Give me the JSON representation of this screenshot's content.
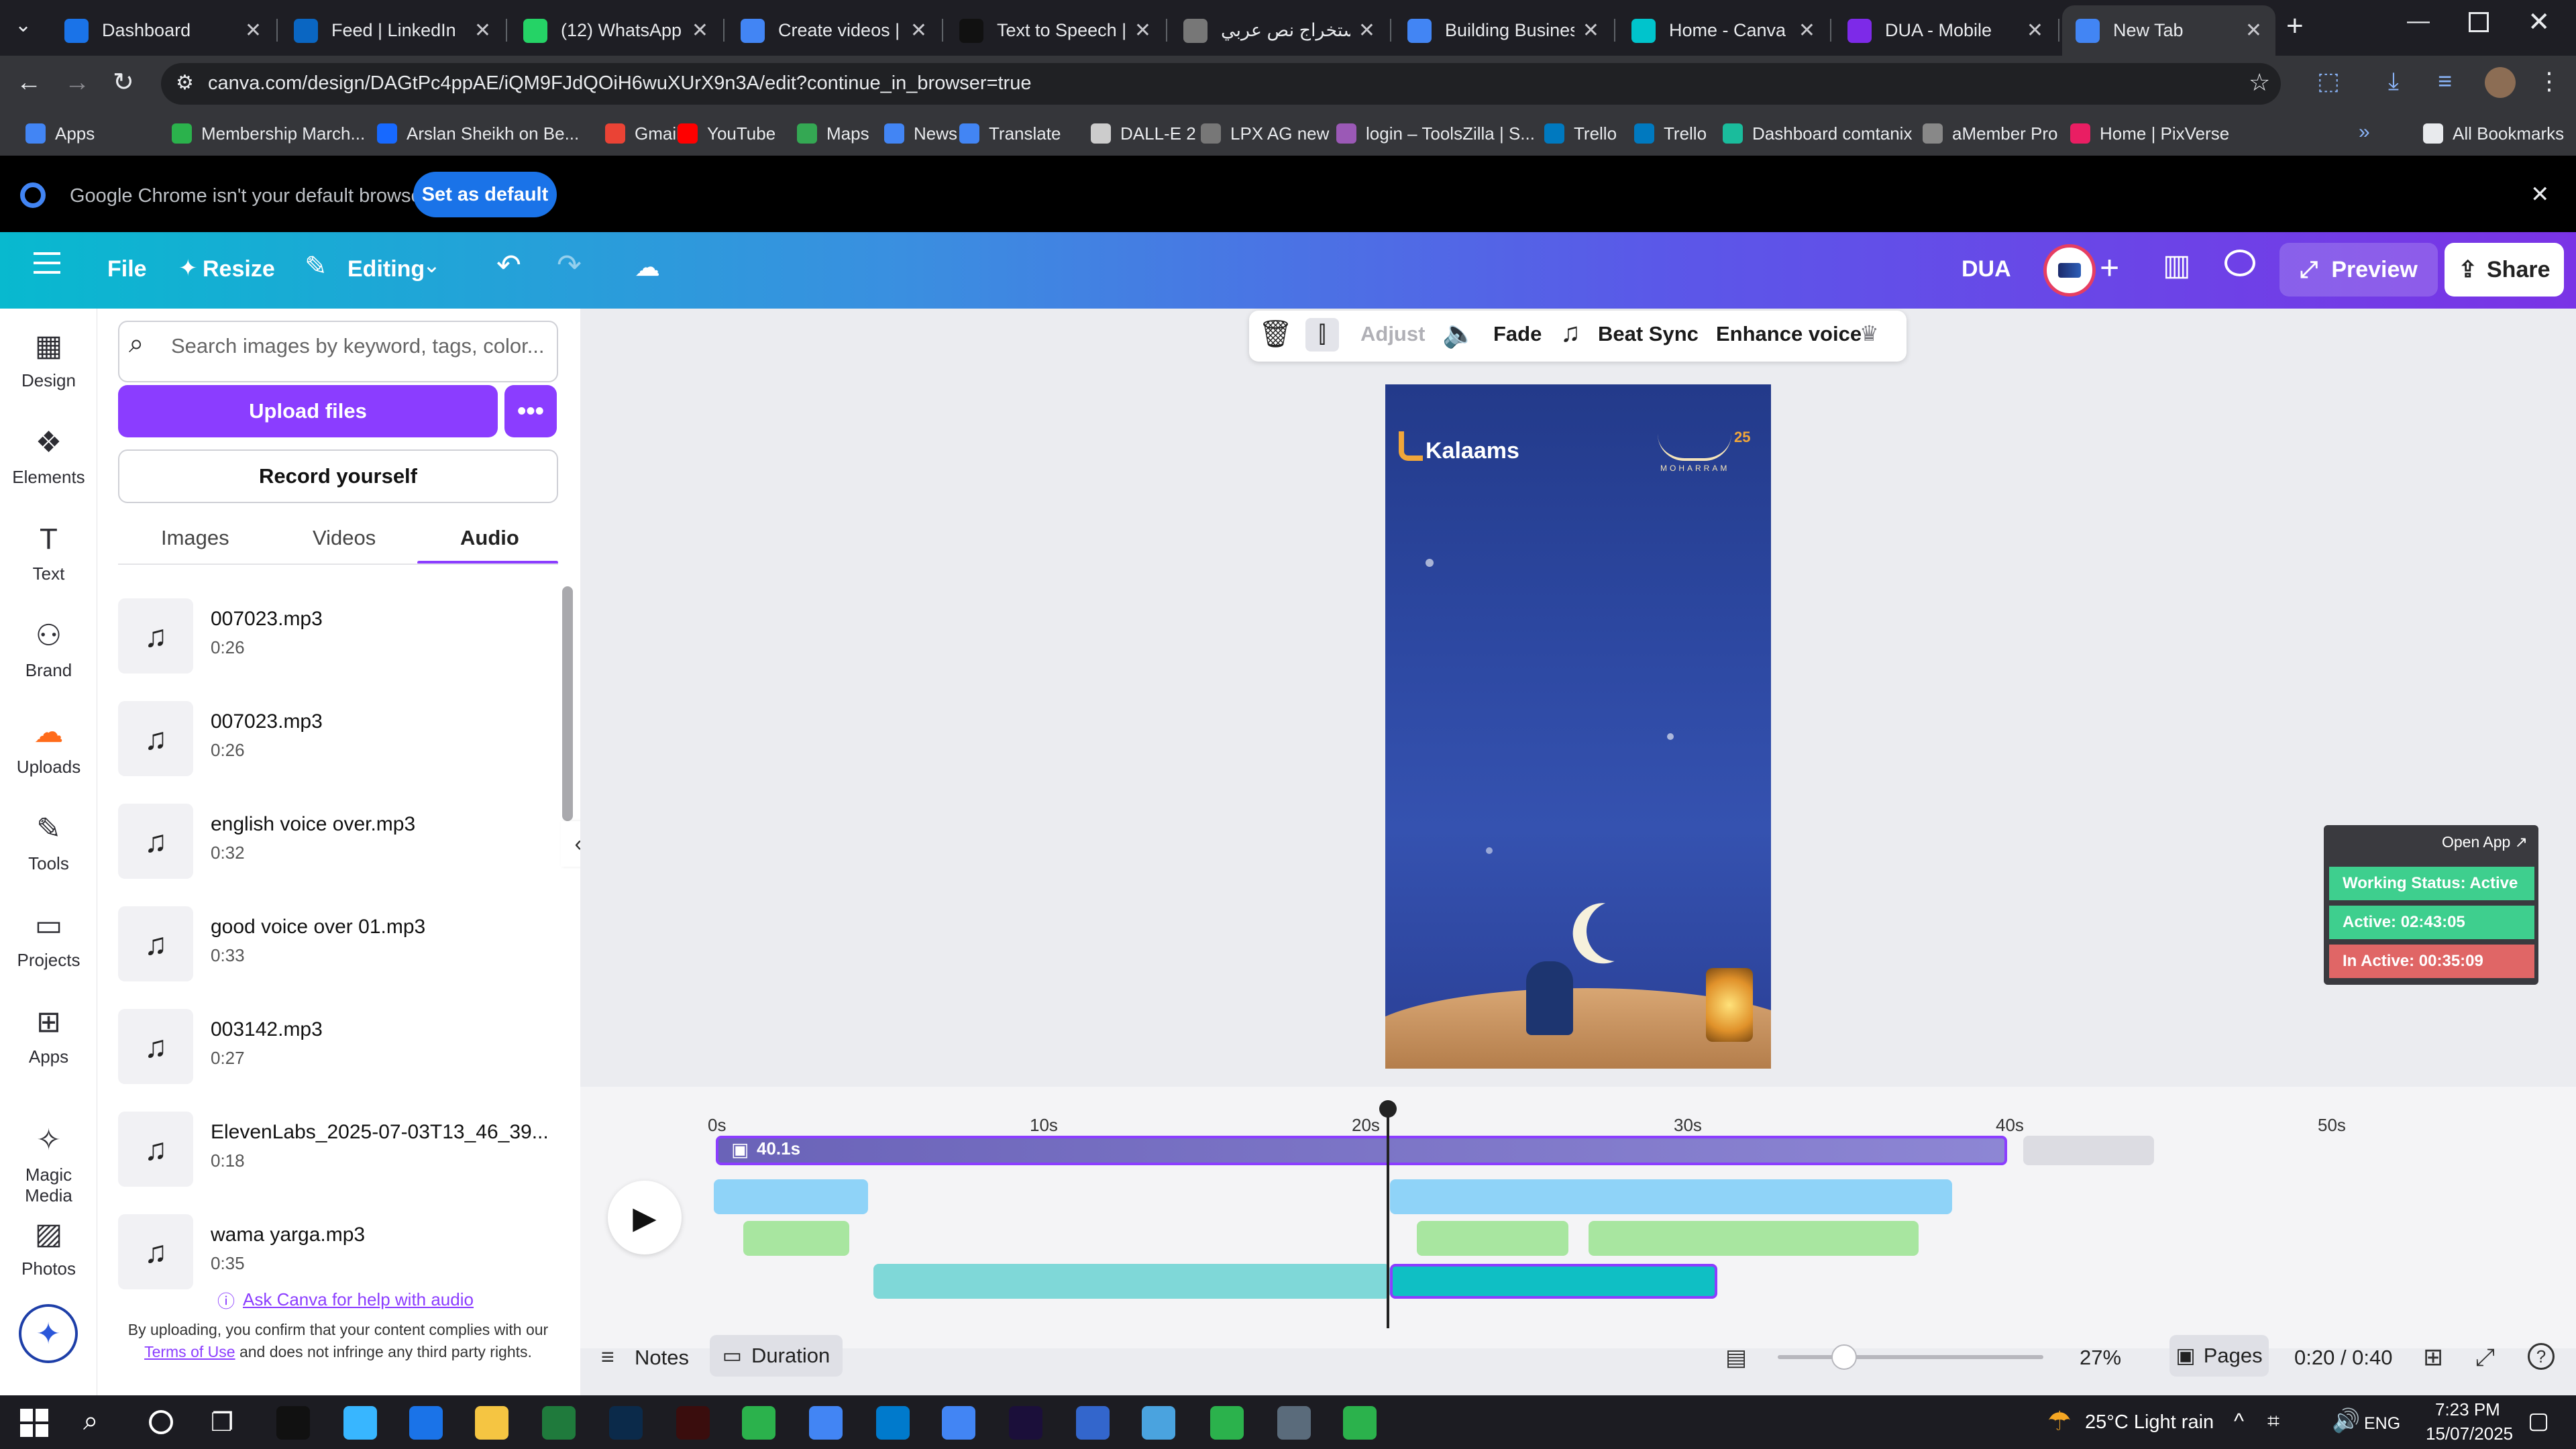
{
  "browser": {
    "tabs": [
      {
        "title": "Dashboard",
        "color": "#1a73e8"
      },
      {
        "title": "Feed | LinkedIn",
        "color": "#0a66c2"
      },
      {
        "title": "(12) WhatsApp",
        "color": "#25d366"
      },
      {
        "title": "Create videos | Fr",
        "color": "#4285f4"
      },
      {
        "title": "Text to Speech | E",
        "color": "#111111"
      },
      {
        "title": "استخراج نص عربي",
        "color": "#777777"
      },
      {
        "title": "Building Business",
        "color": "#4285f4"
      },
      {
        "title": "Home - Canva",
        "color": "#00c4cc"
      },
      {
        "title": "DUA - Mobile",
        "color": "#7d2ae8"
      },
      {
        "title": "New Tab",
        "color": "#4285f4"
      }
    ],
    "url": "canva.com/design/DAGtPc4ppAE/iQM9FJdQOiH6wuXUrX9n3A/edit?continue_in_browser=true",
    "bookmarks": [
      {
        "label": "Apps"
      },
      {
        "label": "Membership March..."
      },
      {
        "label": "Arslan Sheikh on Be..."
      },
      {
        "label": "Gmail"
      },
      {
        "label": "YouTube"
      },
      {
        "label": "Maps"
      },
      {
        "label": "News"
      },
      {
        "label": "Translate"
      },
      {
        "label": "DALL-E 2"
      },
      {
        "label": "LPX AG new"
      },
      {
        "label": "login – ToolsZilla | S..."
      },
      {
        "label": "Trello"
      },
      {
        "label": "Trello"
      },
      {
        "label": "Dashboard comtanix"
      },
      {
        "label": "aMember Pro"
      },
      {
        "label": "Home | PixVerse"
      },
      {
        "label": "All Bookmarks"
      }
    ],
    "infobar": {
      "message": "Google Chrome isn't your default browser",
      "button": "Set as default"
    }
  },
  "canva_header": {
    "file": "File",
    "resize": "Resize",
    "editing": "Editing",
    "design_name": "DUA",
    "preview": "Preview",
    "share": "Share"
  },
  "rail": [
    {
      "label": "Design",
      "icon": "design-icon"
    },
    {
      "label": "Elements",
      "icon": "elements-icon"
    },
    {
      "label": "Text",
      "icon": "text-icon"
    },
    {
      "label": "Brand",
      "icon": "brand-icon"
    },
    {
      "label": "Uploads",
      "icon": "uploads-icon"
    },
    {
      "label": "Tools",
      "icon": "tools-icon"
    },
    {
      "label": "Projects",
      "icon": "projects-icon"
    },
    {
      "label": "Apps",
      "icon": "apps-icon"
    },
    {
      "label": "Magic Media",
      "icon": "magic-media-icon"
    },
    {
      "label": "Photos",
      "icon": "photos-icon"
    }
  ],
  "panel": {
    "search_placeholder": "Search images by keyword, tags, color...",
    "upload_label": "Upload files",
    "record_label": "Record yourself",
    "tabs": [
      "Images",
      "Videos",
      "Audio"
    ],
    "active_tab": "Audio",
    "audio_files": [
      {
        "name": "007023.mp3",
        "duration": "0:26"
      },
      {
        "name": "007023.mp3",
        "duration": "0:26"
      },
      {
        "name": "english voice over.mp3",
        "duration": "0:32"
      },
      {
        "name": "good voice over 01.mp3",
        "duration": "0:33"
      },
      {
        "name": "003142.mp3",
        "duration": "0:27"
      },
      {
        "name": "ElevenLabs_2025-07-03T13_46_39...",
        "duration": "0:18"
      },
      {
        "name": "wama yarga.mp3",
        "duration": "0:35"
      }
    ],
    "help_link": "Ask Canva for help with audio",
    "terms_pre": "By uploading, you confirm that your content complies with our",
    "terms_link": "Terms of Use",
    "terms_post": "and does not infringe any third party rights."
  },
  "context_toolbar": {
    "adjust": "Adjust",
    "fade": "Fade",
    "beat_sync": "Beat Sync",
    "enhance_voice": "Enhance voice"
  },
  "canvas": {
    "brand": "Kalaams",
    "badge_number": "25",
    "badge_sub": "MOHARRAM"
  },
  "status_widget": {
    "open_app": "Open App ↗",
    "working": "Working Status: Active",
    "active": "Active: 02:43:05",
    "inactive": "In Active: 00:35:09",
    "colors": {
      "working": "#3ecf8e",
      "active": "#3ecf8e",
      "inactive": "#e06666"
    }
  },
  "timeline": {
    "ticks": [
      "0s",
      "10s",
      "20s",
      "30s",
      "40s",
      "50s"
    ],
    "clip_duration": "40.1s",
    "playhead_seconds": 20
  },
  "footer": {
    "notes": "Notes",
    "duration": "Duration",
    "zoom": "27%",
    "zoom_fraction": 0.25,
    "pages": "Pages",
    "time": "0:20 / 0:40"
  },
  "taskbar": {
    "weather": "25°C Light rain",
    "lang": "ENG",
    "time": "7:23 PM",
    "date": "15/07/2025"
  }
}
